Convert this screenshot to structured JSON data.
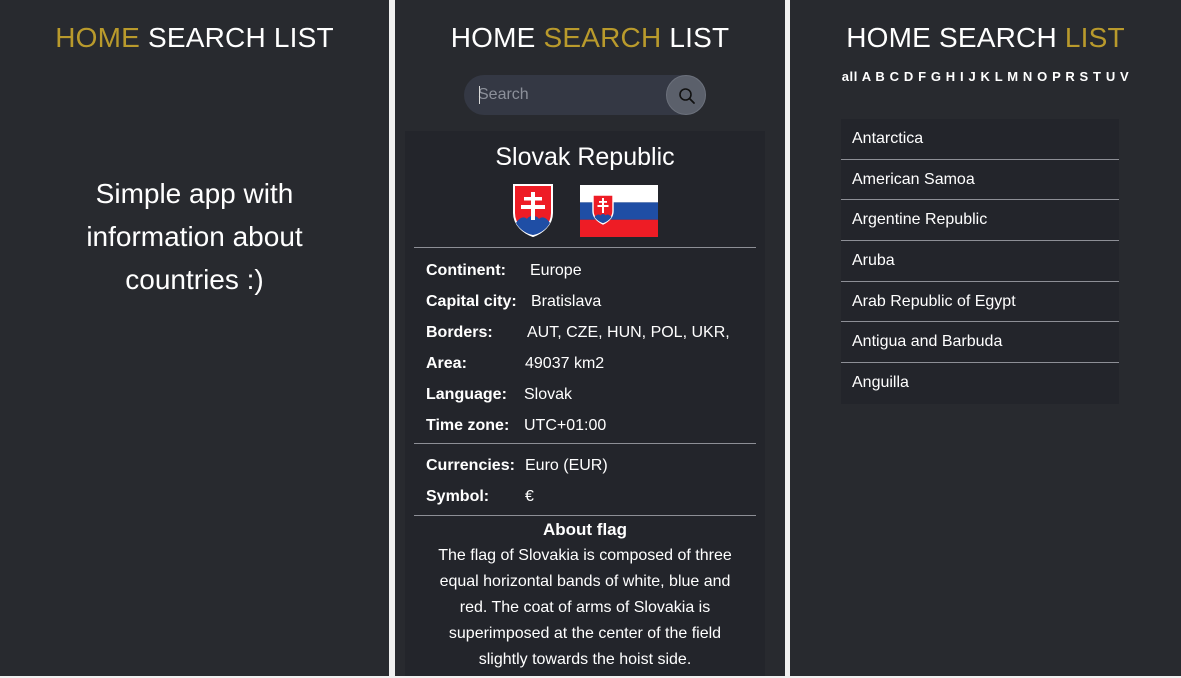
{
  "nav": {
    "home": "HOME",
    "search": "SEARCH",
    "list": "LIST"
  },
  "home_panel": {
    "intro_lines": [
      "Simple app with",
      "information about",
      "countries :)"
    ]
  },
  "search_panel": {
    "search": {
      "placeholder": "Search",
      "value": ""
    },
    "country": {
      "name": "Slovak Republic",
      "details": [
        {
          "label": "Continent:",
          "value": "Europe"
        },
        {
          "label": "Capital city:",
          "value": "Bratislava"
        },
        {
          "label": "Borders:",
          "value": "AUT, CZE, HUN, POL, UKR,"
        },
        {
          "label": "Area:",
          "value": "49037 km2"
        },
        {
          "label": "Language:",
          "value": "Slovak"
        },
        {
          "label": "Time zone:",
          "value": "UTC+01:00"
        }
      ],
      "currency": [
        {
          "label": "Currencies:",
          "value": "Euro (EUR)"
        },
        {
          "label": "Symbol:",
          "value": "€"
        }
      ],
      "about_flag_title": "About flag",
      "about_flag_text": "The flag of Slovakia is composed of three equal horizontal bands of white, blue and red. The coat of arms of Slovakia is superimposed at the center of the field slightly towards the hoist side."
    }
  },
  "list_panel": {
    "letters": [
      "all",
      "A",
      "B",
      "C",
      "D",
      "F",
      "G",
      "H",
      "I",
      "J",
      "K",
      "L",
      "M",
      "N",
      "O",
      "P",
      "R",
      "S",
      "T",
      "U",
      "V"
    ],
    "countries": [
      "Antarctica",
      "American Samoa",
      "Argentine Republic",
      "Aruba",
      "Arab Republic of Egypt",
      "Antigua and Barbuda",
      "Anguilla"
    ]
  },
  "colors": {
    "accent": "#b99a2c",
    "panel_bg": "#282a2f",
    "card_bg": "#23252b",
    "flag_white": "#ffffff",
    "flag_blue": "#1f4ea5",
    "flag_red": "#ee1c25"
  },
  "icons": {
    "search": "search-icon",
    "coat_of_arms": "slovak-coat-of-arms-icon",
    "flag": "slovak-flag-icon"
  }
}
